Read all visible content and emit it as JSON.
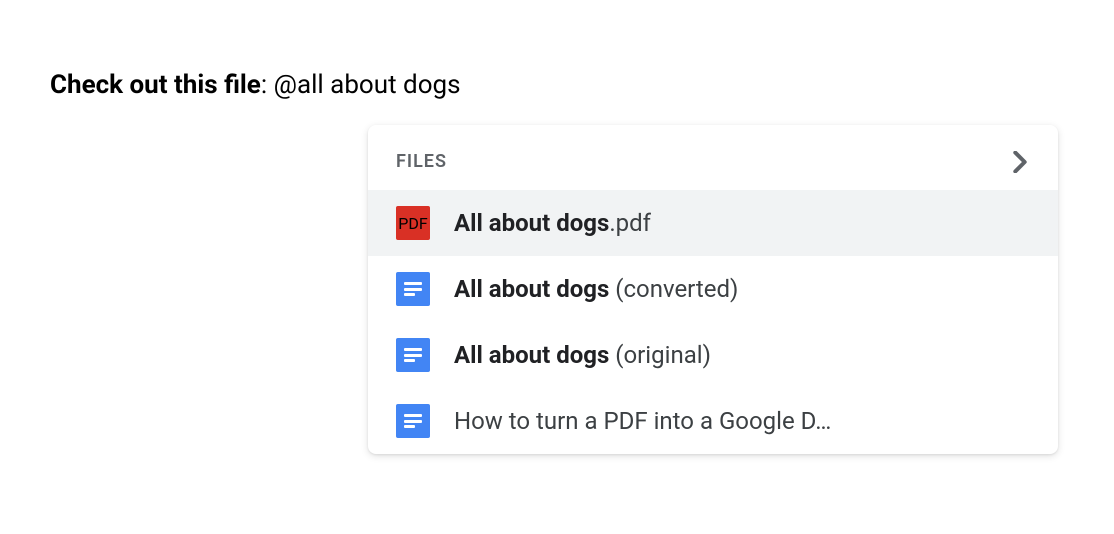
{
  "prompt": {
    "bold": "Check out this file",
    "colon": ": ",
    "mention": "@all about dogs"
  },
  "dropdown": {
    "header_label": "FILES",
    "items": [
      {
        "type": "pdf",
        "icon_label": "PDF",
        "highlighted": true,
        "name_bold": "All about dogs",
        "name_suffix": ".pdf"
      },
      {
        "type": "gdoc",
        "highlighted": false,
        "name_bold": "All about dogs",
        "name_suffix": " (converted)"
      },
      {
        "type": "gdoc",
        "highlighted": false,
        "name_bold": "All about dogs",
        "name_suffix": " (original)"
      },
      {
        "type": "gdoc",
        "highlighted": false,
        "name_bold": "",
        "name_suffix": "How to turn a PDF into a Google D…"
      }
    ]
  }
}
